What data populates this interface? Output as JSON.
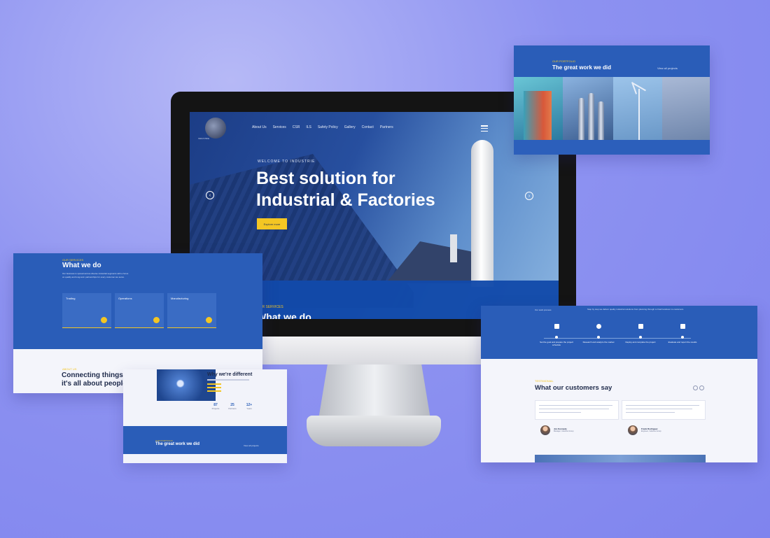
{
  "screen": {
    "logo_text": "INDUSTRIE",
    "nav": [
      "About Us",
      "Services",
      "CSR",
      "ILS",
      "Safety Policy",
      "Gallery",
      "Contact",
      "Partners"
    ],
    "welcome": "WELCOME TO INDUSTRIE",
    "hero_title_line1": "Best solution for",
    "hero_title_line2": "Industrial & Factories",
    "cta": "Explore more",
    "prev_arrow": "‹",
    "next_arrow": "›",
    "services_label": "OUR SERVICES",
    "services_title": "What we do"
  },
  "work_card": {
    "eyebrow": "OUR PORTFOLIO",
    "title": "The great work we did",
    "link": "View all projects"
  },
  "what_we_do": {
    "eyebrow": "OUR SERVICES",
    "title": "What we do",
    "description": "Our business is spread across diverse industrial segments with a focus on quality and long-term partnerships for every customer we serve.",
    "services": [
      {
        "label": "Trading"
      },
      {
        "label": "Operations"
      },
      {
        "label": "Manufacturing"
      }
    ],
    "eyebrow2": "ABOUT US",
    "connect_line1": "Connecting things,",
    "connect_line2": "it's all about people."
  },
  "why_card": {
    "title": "Why we're different",
    "stats": [
      {
        "value": "87",
        "label": "Projects"
      },
      {
        "value": "25",
        "label": "Partners"
      },
      {
        "value": "12+",
        "label": "Years"
      }
    ],
    "eyebrow": "OUR PORTFOLIO",
    "work_title": "The great work we did",
    "link": "View all projects"
  },
  "customers_card": {
    "band_left": "Our work process",
    "band_right": "Step by step we deliver quality industrial solutions from planning through to final handover to customers.",
    "steps": [
      {
        "label": "Set the goal and prepare the project schedule"
      },
      {
        "label": "Research and analyze the market"
      },
      {
        "label": "Deploy and complete the project"
      },
      {
        "label": "Evaluate and report the results"
      }
    ],
    "eyebrow": "TESTIMONIAL",
    "title": "What our customers say",
    "authors": [
      {
        "name": "Jon Kennedy",
        "role": "Manager, Industrie Group"
      },
      {
        "name": "Frank Rodriguez",
        "role": "Engineer, Industrie Group"
      }
    ]
  },
  "colors": {
    "brand_blue": "#2a5db8",
    "accent_yellow": "#f4c623",
    "background_violet": "#8d92f1"
  }
}
